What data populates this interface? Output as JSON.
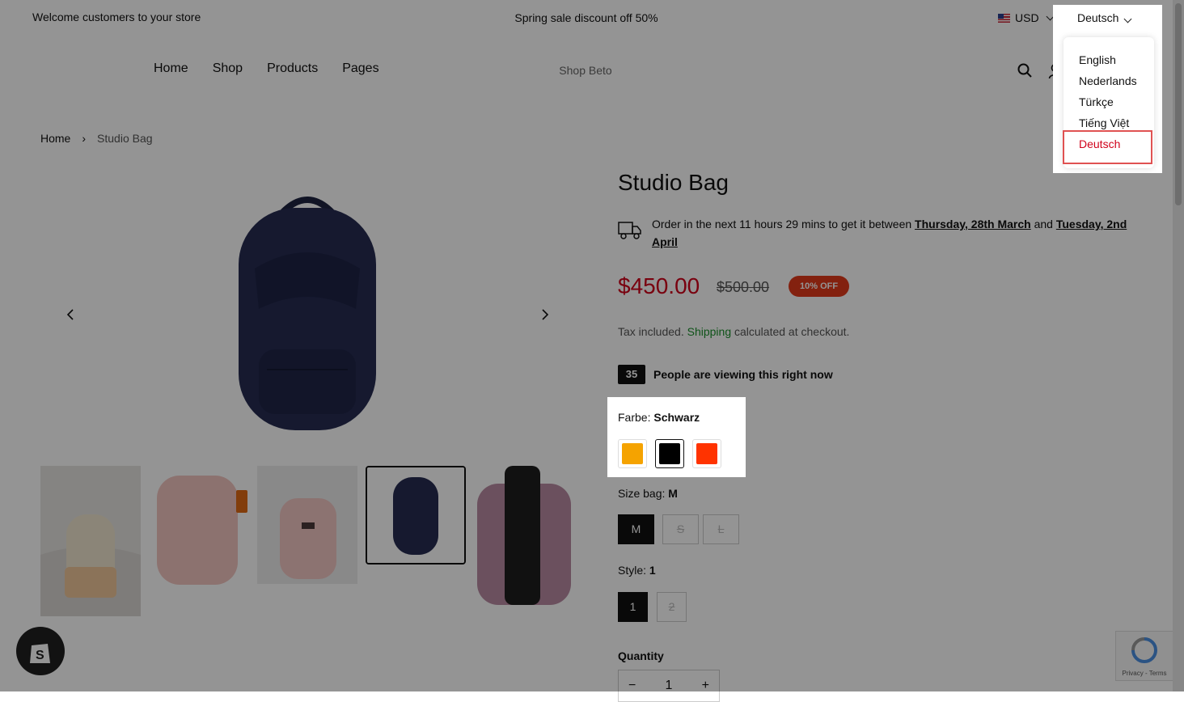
{
  "topbar": {
    "welcome": "Welcome customers to your store",
    "promo": "Spring sale discount off 50%",
    "currency": "USD",
    "language": "Deutsch"
  },
  "header": {
    "nav": [
      "Home",
      "Shop",
      "Products",
      "Pages"
    ],
    "logo": "Shop Beto"
  },
  "breadcrumb": {
    "home": "Home",
    "separator": "›",
    "current": "Studio Bag"
  },
  "product": {
    "title": "Studio Bag",
    "delivery_prefix": "Order in the next 11 hours 29 mins to get it between ",
    "delivery_date1": "Thursday, 28th March",
    "delivery_and": " and ",
    "delivery_date2": "Tuesday, 2nd April",
    "price": "$450.00",
    "compare_price": "$500.00",
    "discount_badge": "10% OFF",
    "tax_prefix": "Tax included. ",
    "tax_link": "Shipping",
    "tax_suffix": " calculated at checkout.",
    "viewers_count": "35",
    "viewers_text": "People are viewing this right now",
    "color_label": "Farbe: ",
    "color_value": "Schwarz",
    "colors": [
      "#f5a300",
      "#000000",
      "#ff3300"
    ],
    "size_label": "Size bag: ",
    "size_value": "M",
    "sizes": [
      "M",
      "S",
      "L"
    ],
    "style_label": "Style: ",
    "style_value": "1",
    "styles": [
      "1",
      "2"
    ],
    "quantity_label": "Quantity",
    "quantity_value": "1",
    "qty_minus": "−",
    "qty_plus": "+"
  },
  "languages": {
    "items": [
      "English",
      "Nederlands",
      "Türkçe",
      "Tiếng Việt",
      "Deutsch"
    ],
    "selected": "Deutsch"
  },
  "recaptcha": {
    "text": "Privacy - Terms"
  }
}
